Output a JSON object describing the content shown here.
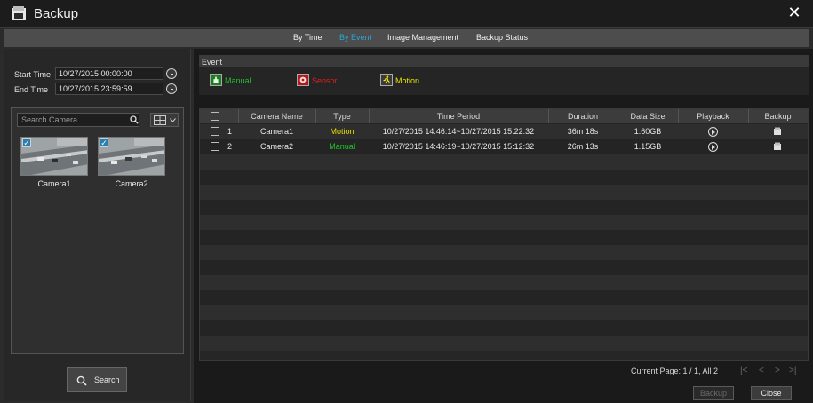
{
  "window": {
    "title": "Backup"
  },
  "tabs": [
    {
      "label": "By Time",
      "active": false
    },
    {
      "label": "By Event",
      "active": true
    },
    {
      "label": "Image Management",
      "active": false
    },
    {
      "label": "Backup Status",
      "active": false
    }
  ],
  "filters": {
    "start_label": "Start Time",
    "start_value": "10/27/2015 00:00:00",
    "end_label": "End Time",
    "end_value": "10/27/2015 23:59:59"
  },
  "camera_panel": {
    "search_placeholder": "Search Camera",
    "cameras": [
      {
        "name": "Camera1",
        "checked": true
      },
      {
        "name": "Camera2",
        "checked": true
      }
    ]
  },
  "search_button": "Search",
  "events": {
    "label": "Event",
    "items": [
      {
        "label": "Manual",
        "color": "#22c22a",
        "icon": "manual-icon"
      },
      {
        "label": "Sensor",
        "color": "#e02020",
        "icon": "sensor-icon"
      },
      {
        "label": "Motion",
        "color": "#e8e000",
        "icon": "motion-icon"
      }
    ]
  },
  "table": {
    "headers": [
      "Camera Name",
      "Type",
      "Time Period",
      "Duration",
      "Data Size",
      "Playback",
      "Backup"
    ],
    "rows": [
      {
        "no": "1",
        "camera": "Camera1",
        "type": "Motion",
        "type_color": "#e8e000",
        "period": "10/27/2015 14:46:14~10/27/2015 15:22:32",
        "duration": "36m 18s",
        "size": "1.60GB"
      },
      {
        "no": "2",
        "camera": "Camera2",
        "type": "Manual",
        "type_color": "#22c22a",
        "period": "10/27/2015 14:46:19~10/27/2015 15:12:32",
        "duration": "26m 13s",
        "size": "1.15GB"
      }
    ]
  },
  "footer": {
    "page_info": "Current Page: 1 / 1, All 2",
    "backup_label": "Backup",
    "close_label": "Close"
  }
}
